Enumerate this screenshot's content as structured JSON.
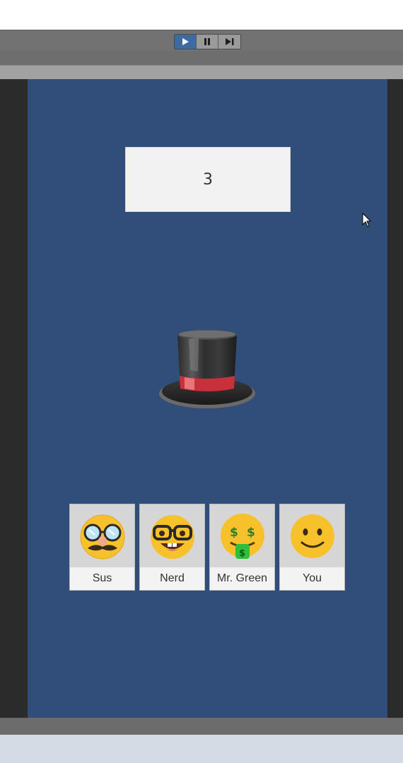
{
  "toolbar": {
    "buttons": [
      {
        "icon": "play-icon",
        "active": true
      },
      {
        "icon": "pause-icon",
        "active": false
      },
      {
        "icon": "step-icon",
        "active": false
      }
    ]
  },
  "game": {
    "counter": "3",
    "center_icon": "top-hat-icon",
    "players": [
      {
        "name": "Sus",
        "icon": "disguised-face-icon"
      },
      {
        "name": "Nerd",
        "icon": "nerd-face-icon"
      },
      {
        "name": "Mr. Green",
        "icon": "money-mouth-face-icon"
      },
      {
        "name": "You",
        "icon": "slightly-smiling-face-icon"
      }
    ]
  },
  "colors": {
    "canvas_bg": "#314d79",
    "play_active": "#3d6aa2",
    "toolbar_bg": "#727272"
  }
}
